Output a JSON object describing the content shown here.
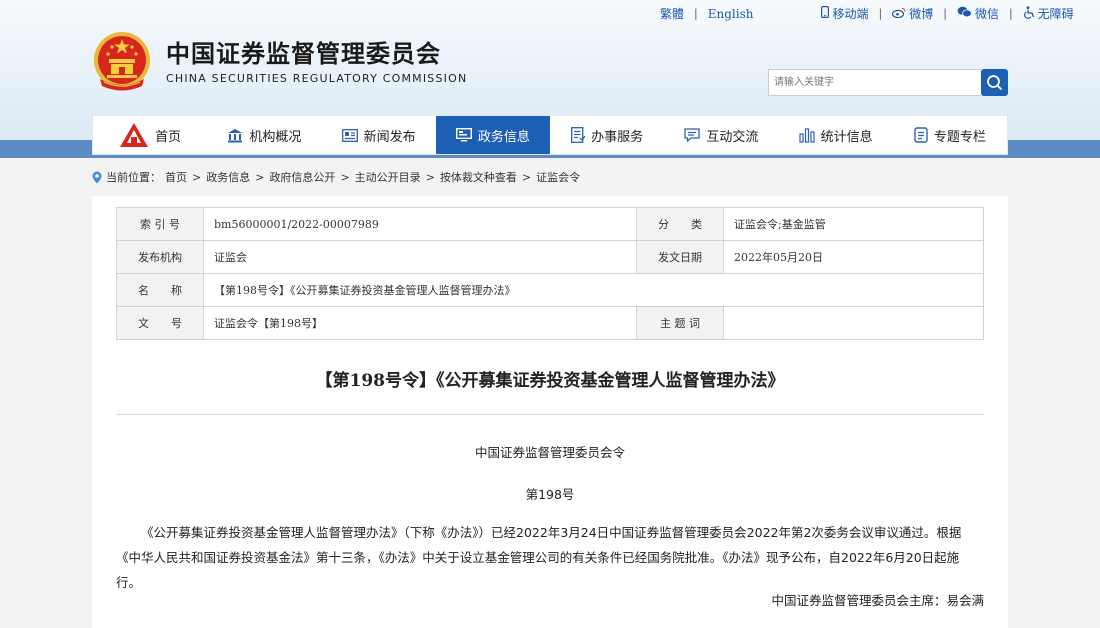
{
  "top_links": {
    "traditional": "繁體",
    "english": "English",
    "mobile": "移动端",
    "weibo": "微博",
    "wechat": "微信",
    "accessibility": "无障碍"
  },
  "brand": {
    "name_cn": "中国证券监督管理委员会",
    "name_en": "CHINA SECURITIES REGULATORY COMMISSION"
  },
  "search": {
    "placeholder": "请输入关键字"
  },
  "nav": {
    "items": [
      {
        "label": "首页",
        "icon": "home-logo-icon"
      },
      {
        "label": "机构概况",
        "icon": "building-icon"
      },
      {
        "label": "新闻发布",
        "icon": "newspaper-icon"
      },
      {
        "label": "政务信息",
        "icon": "monitor-icon"
      },
      {
        "label": "办事服务",
        "icon": "document-icon"
      },
      {
        "label": "互动交流",
        "icon": "chat-icon"
      },
      {
        "label": "统计信息",
        "icon": "bar-chart-icon"
      },
      {
        "label": "专题专栏",
        "icon": "notes-icon"
      }
    ],
    "active_index": 3
  },
  "breadcrumb": {
    "prefix": "当前位置：",
    "items": [
      "首页",
      "政务信息",
      "政府信息公开",
      "主动公开目录",
      "按体裁文种查看",
      "证监会令"
    ]
  },
  "meta": {
    "index_label": "索 引 号",
    "index_value": "bm56000001/2022-00007989",
    "category_label": "分　　类",
    "category_value": "证监会令;基金监管",
    "publisher_label": "发布机构",
    "publisher_value": "证监会",
    "date_label": "发文日期",
    "date_value": "2022年05月20日",
    "name_label": "名　　称",
    "name_value": "【第198号令】《公开募集证券投资基金管理人监督管理办法》",
    "docno_label": "文　　号",
    "docno_value": "证监会令【第198号】",
    "subject_label": "主 题 词",
    "subject_value": ""
  },
  "document": {
    "title": "【第198号令】《公开募集证券投资基金管理人监督管理办法》",
    "issuer": "中国证券监督管理委员会令",
    "order_no": "第198号",
    "body": "《公开募集证券投资基金管理人监督管理办法》（下称《办法》）已经2022年3月24日中国证券监督管理委员会2022年第2次委务会议审议通过。根据《中华人民共和国证券投资基金法》第十三条，《办法》中关于设立基金管理公司的有关条件已经国务院批准。《办法》现予公布，自2022年6月20日起施行。",
    "signature": "中国证券监督管理委员会主席：易会满"
  },
  "colors": {
    "primary": "#1d5fb5",
    "band": "#5b8cc4",
    "emblem_red": "#d7261e",
    "emblem_gold": "#e9b83a"
  }
}
